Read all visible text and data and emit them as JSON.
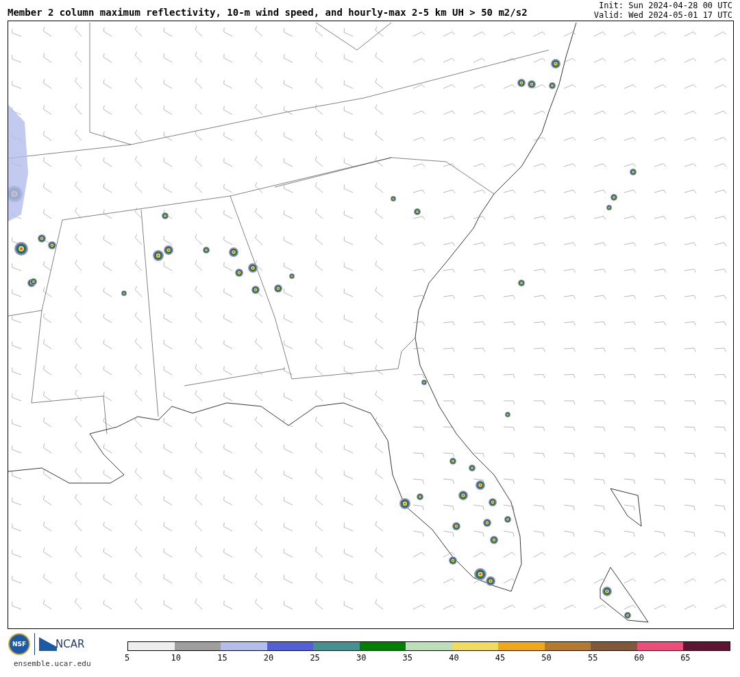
{
  "title": "Member 2 column maximum reflectivity, 10-m wind speed, and hourly-max 2-5 km UH > 50 m2/s2",
  "init": "Init: Sun 2024-04-28 00 UTC",
  "valid": "Valid: Wed 2024-05-01 17 UTC",
  "logos": {
    "nsf": "NSF",
    "ncar": "NCAR",
    "site": "ensemble.ucar.edu"
  },
  "colorbar": {
    "bins": [
      {
        "color": "#eeeeee"
      },
      {
        "color": "#9e9e9e"
      },
      {
        "color": "#b3bdec"
      },
      {
        "color": "#525fd8"
      },
      {
        "color": "#45918f"
      },
      {
        "color": "#008000"
      },
      {
        "color": "#badfba"
      },
      {
        "color": "#f1db5c"
      },
      {
        "color": "#f0a818"
      },
      {
        "color": "#b57b2c"
      },
      {
        "color": "#835839"
      },
      {
        "color": "#ee4c7b"
      },
      {
        "color": "#5e1534"
      }
    ],
    "ticks": [
      "5",
      "10",
      "15",
      "20",
      "25",
      "30",
      "35",
      "40",
      "45",
      "50",
      "55",
      "60",
      "65"
    ]
  }
}
